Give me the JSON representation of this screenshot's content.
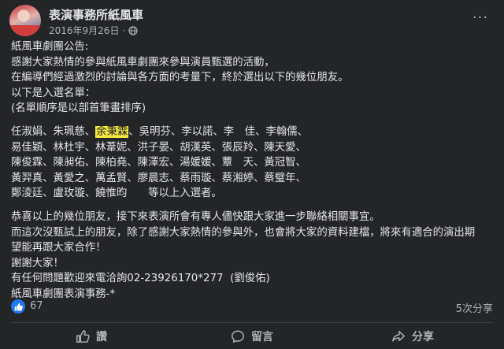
{
  "post": {
    "page_name": "表演事務所紙風車",
    "date": "2016年9月26日",
    "more_label": "···",
    "lines_a": [
      "紙風車劇團公告:",
      "感謝大家熱情的參與紙風車劇團來參與演員甄選的活動，",
      "在編導們經過激烈的討論與各方面的考量下，終於選出以下的幾位朋友。",
      "以下是入選名單：",
      "(名單順序是以部首筆畫排序)"
    ],
    "names_line1_pre": "任淑娟、朱珮慈、",
    "names_line1_hl": "余秉霖",
    "names_line1_post": "、吳明芬、李以諾、李　佳、李翰儒、",
    "names_lines": [
      "易佳穎、林杜宇、林葦妮、洪子晏、胡漢英、張辰羚、陳天愛、",
      "陳俊霖、陳昶佑、陳柏堯、陳澤宏、湯媛媛、蕈　天、黃冠智、",
      "黃羿真、黃愛之、萬孟賢、廖晨志、蔡雨璇、蔡湘婷、蔡璧年、",
      "鄭淩廷、盧玫璇、饒惟昀　　等以上入選者。"
    ],
    "lines_b": [
      "恭喜以上的幾位朋友，接下來表演所會有專人儘快跟大家進一步聯絡相關事宜。",
      "而這次沒甄試上的朋友，除了感謝大家熱情的參與外，也會將大家的資料建檔，將來有適合的演出期",
      "望能再跟大家合作！",
      "謝謝大家！",
      "有任何問題歡迎來電洽詢02-23926170*277  (劉俊佑)",
      "紙風車劇團表演事務-*"
    ]
  },
  "stats": {
    "like_count": "67",
    "share_count": "5次分享"
  },
  "actions": {
    "like_label": "讚",
    "comment_label": "留言",
    "share_label": "分享"
  },
  "colors": {
    "background": "#242526",
    "highlight": "#f5e942",
    "like_blue": "#2078f4"
  }
}
